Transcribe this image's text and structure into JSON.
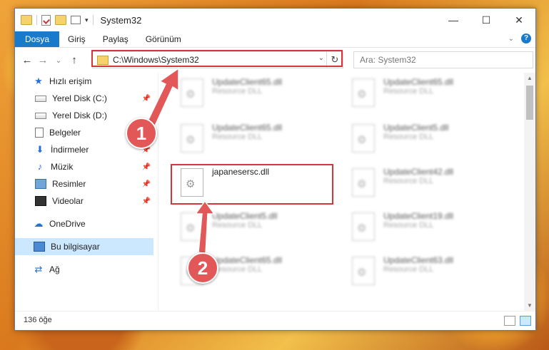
{
  "window": {
    "title": "System32"
  },
  "ribbon": {
    "tabs": [
      "Dosya",
      "Giriş",
      "Paylaş",
      "Görünüm"
    ],
    "help": "?"
  },
  "nav": {
    "back": "←",
    "forward": "→",
    "recent": "⌄",
    "up": "↑"
  },
  "address": {
    "path": "C:\\Windows\\System32",
    "refresh": "↻"
  },
  "search": {
    "placeholder": "Ara: System32"
  },
  "sidebar": {
    "quick_access": "Hızlı erişim",
    "items": [
      {
        "label": "Yerel Disk (C:)",
        "icon": "drive-icon",
        "pinned": true
      },
      {
        "label": "Yerel Disk (D:)",
        "icon": "drive-icon",
        "pinned": false
      },
      {
        "label": "Belgeler",
        "icon": "documents-icon",
        "pinned": true
      },
      {
        "label": "İndirmeler",
        "icon": "downloads-icon",
        "pinned": true
      },
      {
        "label": "Müzik",
        "icon": "music-icon",
        "pinned": true
      },
      {
        "label": "Resimler",
        "icon": "pictures-icon",
        "pinned": true
      },
      {
        "label": "Videolar",
        "icon": "videos-icon",
        "pinned": true
      }
    ],
    "onedrive": "OneDrive",
    "this_pc": "Bu bilgisayar",
    "network": "Ağ"
  },
  "files": [
    {
      "name": "UpdateClient65.dll",
      "type": "Resource DLL",
      "blurred": true
    },
    {
      "name": "UpdateClient65.dll",
      "type": "Resource DLL",
      "blurred": true
    },
    {
      "name": "UpdateClient65.dll",
      "type": "Resource DLL",
      "blurred": true
    },
    {
      "name": "UpdateClient5.dll",
      "type": "Resource DLL",
      "blurred": true
    },
    {
      "name": "japanesersc.dll",
      "type": "",
      "blurred": false
    },
    {
      "name": "UpdateClient42.dll",
      "type": "Resource DLL",
      "blurred": true
    },
    {
      "name": "UpdateClient5.dll",
      "type": "Resource DLL",
      "blurred": true
    },
    {
      "name": "UpdateClient19.dll",
      "type": "Resource DLL",
      "blurred": true
    },
    {
      "name": "UpdateClient65.dll",
      "type": "Resource DLL",
      "blurred": true
    },
    {
      "name": "UpdateClient63.dll",
      "type": "Resource DLL",
      "blurred": true
    }
  ],
  "status": {
    "item_count": "136 öğe"
  },
  "callouts": {
    "one": "1",
    "two": "2"
  },
  "colors": {
    "accent": "#1979ca",
    "highlight": "#d8353b",
    "callout": "#e25758"
  }
}
